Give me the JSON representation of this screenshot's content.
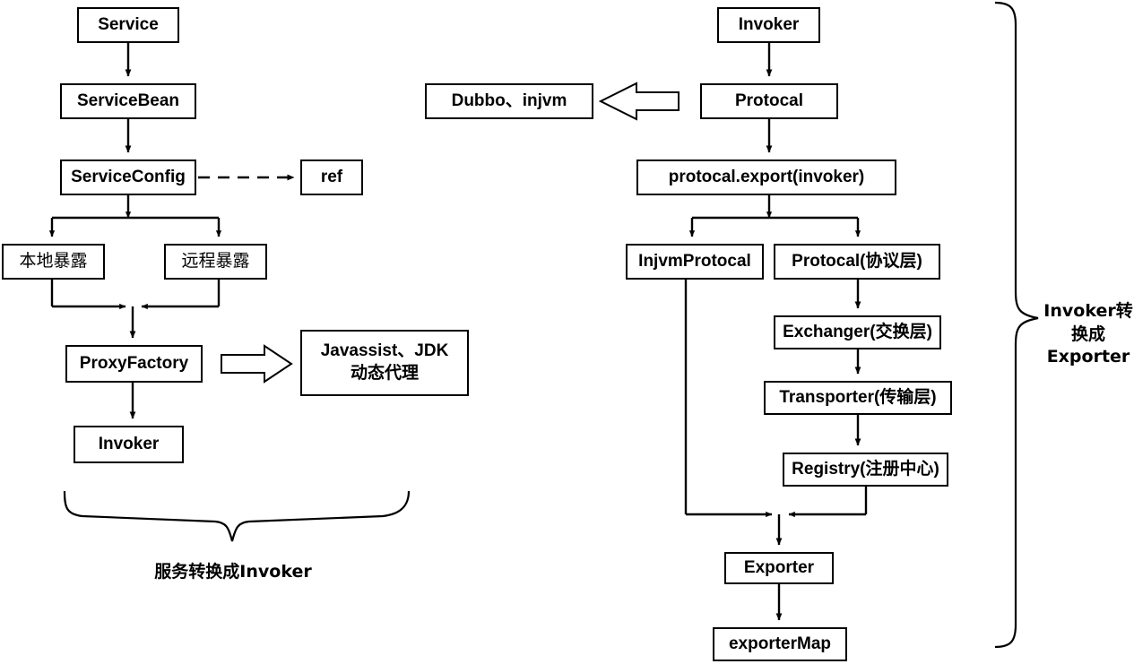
{
  "diagram": {
    "title": "Dubbo service export flow diagram",
    "background_color": "#ffffff",
    "line_color": "#000000",
    "left_column": {
      "nodes": [
        {
          "id": "service",
          "label": "Service"
        },
        {
          "id": "service-bean",
          "label": "ServiceBean"
        },
        {
          "id": "service-config",
          "label": "ServiceConfig"
        },
        {
          "id": "ref",
          "label": "ref"
        },
        {
          "id": "local-export",
          "label": "本地暴露"
        },
        {
          "id": "remote-export",
          "label": "远程暴露"
        },
        {
          "id": "proxy-factory",
          "label": "ProxyFactory"
        },
        {
          "id": "javassist-jdk",
          "label_line1": "Javassist、JDK",
          "label_line2": "动态代理"
        },
        {
          "id": "invoker-left",
          "label": "Invoker"
        }
      ],
      "brace_caption": "服务转换成Invoker"
    },
    "right_column": {
      "nodes": [
        {
          "id": "invoker-right",
          "label": "Invoker"
        },
        {
          "id": "protocal",
          "label": "Protocal"
        },
        {
          "id": "dubbo-injvm",
          "label": "Dubbo、injvm"
        },
        {
          "id": "protocal-export",
          "label": "protocal.export(invoker)"
        },
        {
          "id": "injvm-protocal",
          "label": "InjvmProtocal"
        },
        {
          "id": "protocal-layer",
          "label": "Protocal(协议层)"
        },
        {
          "id": "exchanger-layer",
          "label": "Exchanger(交换层)"
        },
        {
          "id": "transporter-layer",
          "label": "Transporter(传输层)"
        },
        {
          "id": "registry-layer",
          "label": "Registry(注册中心)"
        },
        {
          "id": "exporter",
          "label": "Exporter"
        },
        {
          "id": "exporter-map",
          "label": "exporterMap"
        }
      ],
      "brace_caption_line1": "Invoker转",
      "brace_caption_line2": "换成",
      "brace_caption_line3": "Exporter"
    }
  }
}
